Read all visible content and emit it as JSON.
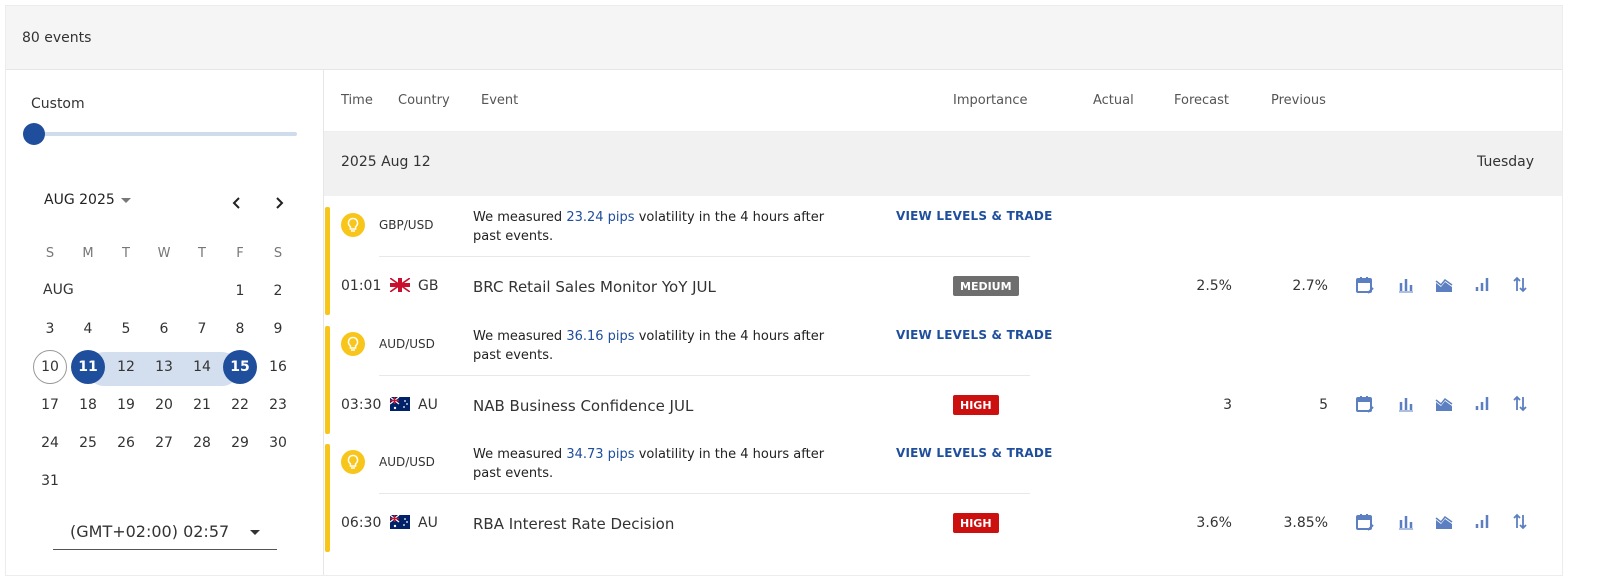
{
  "header": {
    "events_count": "80 events"
  },
  "sidebar": {
    "range_label": "Custom",
    "slider_value": 0,
    "calendar": {
      "month_title": "AUG 2025",
      "month_short": "AUG",
      "weekdays": [
        "S",
        "M",
        "T",
        "W",
        "T",
        "F",
        "S"
      ],
      "today": "10",
      "range_start": "11",
      "range_mid": [
        "12",
        "13",
        "14"
      ],
      "range_end": "15",
      "days": [
        "1",
        "2",
        "3",
        "4",
        "5",
        "6",
        "7",
        "8",
        "9",
        "10",
        "11",
        "12",
        "13",
        "14",
        "15",
        "16",
        "17",
        "18",
        "19",
        "20",
        "21",
        "22",
        "23",
        "24",
        "25",
        "26",
        "27",
        "28",
        "29",
        "30",
        "31"
      ]
    },
    "timezone": "(GMT+02:00) 02:57"
  },
  "table": {
    "columns": {
      "time": "Time",
      "country": "Country",
      "event": "Event",
      "importance": "Importance",
      "actual": "Actual",
      "forecast": "Forecast",
      "previous": "Previous"
    },
    "date_label": "2025 Aug 12",
    "weekday": "Tuesday"
  },
  "events": [
    {
      "pair": "GBP/USD",
      "vol_prefix": "We measured ",
      "pips": "23.24 pips",
      "vol_suffix": " volatility in the 4 hours after past events.",
      "trade_label": "VIEW LEVELS & TRADE",
      "time": "01:01",
      "country": "GB",
      "name": "BRC Retail Sales Monitor YoY JUL",
      "importance": "MEDIUM",
      "forecast": "2.5%",
      "previous": "2.7%"
    },
    {
      "pair": "AUD/USD",
      "vol_prefix": "We measured ",
      "pips": "36.16 pips",
      "vol_suffix": " volatility in the 4 hours after past events.",
      "trade_label": "VIEW LEVELS & TRADE",
      "time": "03:30",
      "country": "AU",
      "name": "NAB Business Confidence JUL",
      "importance": "HIGH",
      "forecast": "3",
      "previous": "5"
    },
    {
      "pair": "AUD/USD",
      "vol_prefix": "We measured ",
      "pips": "34.73 pips",
      "vol_suffix": " volatility in the 4 hours after past events.",
      "trade_label": "VIEW LEVELS & TRADE",
      "time": "06:30",
      "country": "AU",
      "name": "RBA Interest Rate Decision",
      "importance": "HIGH",
      "forecast": "3.6%",
      "previous": "3.85%"
    }
  ],
  "colors": {
    "accent_blue": "#1f4e9c",
    "icon_blue": "#5b7fc0",
    "volatility_yellow": "#f8c51a",
    "medium_badge": "#6e6e6e",
    "high_badge": "#cc1010"
  },
  "row_icons": [
    "calendar-edit-icon",
    "bar-chart-icon",
    "area-chart-icon",
    "bars-ascending-icon",
    "sort-arrows-icon"
  ]
}
